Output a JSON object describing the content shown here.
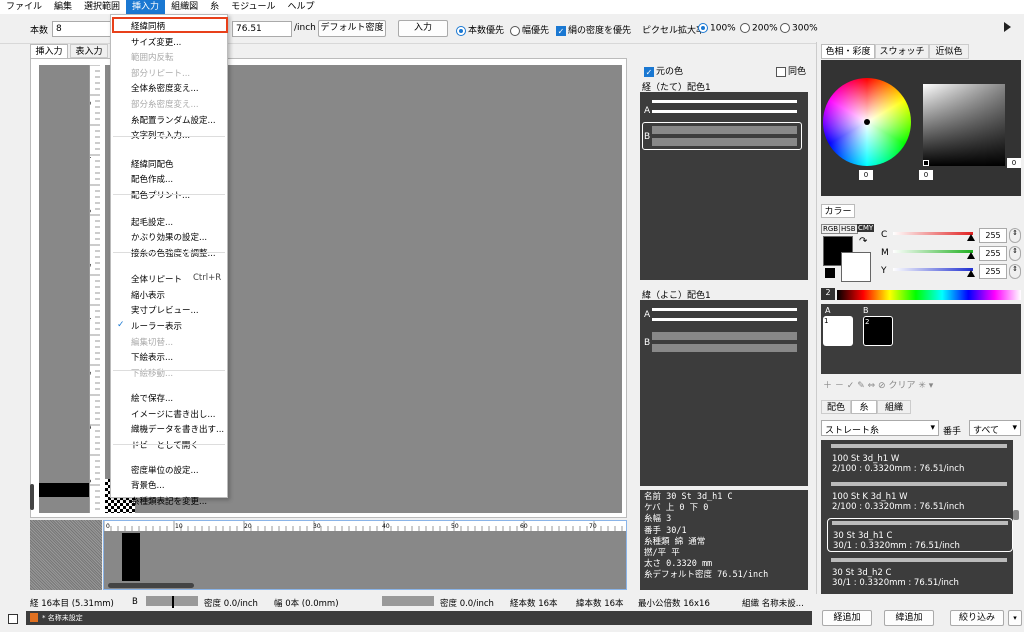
{
  "menubar": {
    "items": [
      "ファイル",
      "編集",
      "選択範囲",
      "挿入力",
      "組織図",
      "糸",
      "モジュール",
      "ヘルプ"
    ],
    "active_index": 3
  },
  "toolbar": {
    "count_label": "本数",
    "count_value": "8",
    "density_value": "76.51",
    "per_inch": "/inch",
    "default_density_btn": "デフォルト密度",
    "input_btn": "入力",
    "priority_count": "本数優先",
    "priority_width": "幅優先",
    "keep_density": "絹の密度を優先",
    "pixel_zoom_label": "ピクセル拡大率",
    "zoom_100": "100%",
    "zoom_200": "200%",
    "zoom_300": "300%",
    "play_icon": "play-icon"
  },
  "left_tabs": [
    "挿入力",
    "表入力"
  ],
  "dropdown": {
    "items": [
      {
        "label": "経緯同柄",
        "disabled": false,
        "highlighted": true
      },
      {
        "label": "サイズ変更...",
        "disabled": false
      },
      {
        "label": "範囲内反転",
        "disabled": true
      },
      {
        "label": "部分リピート...",
        "disabled": true
      },
      {
        "label": "全体糸密度変え...",
        "disabled": false
      },
      {
        "label": "部分糸密度変え...",
        "disabled": true
      },
      {
        "label": "糸配置ランダム設定...",
        "disabled": false
      },
      {
        "label": "文字列で入力...",
        "disabled": false
      },
      {
        "label": "経緯同配色",
        "disabled": false
      },
      {
        "label": "配色作成...",
        "disabled": false
      },
      {
        "label": "配色プリント...",
        "disabled": false
      },
      {
        "label": "起毛設定...",
        "disabled": false
      },
      {
        "label": "かぶり効果の設定...",
        "disabled": false
      },
      {
        "label": "接糸の色強度を調整...",
        "disabled": false
      },
      {
        "label": "全体リピート",
        "disabled": false,
        "shortcut": "Ctrl+R"
      },
      {
        "label": "縮小表示",
        "disabled": false
      },
      {
        "label": "実寸プレビュー...",
        "disabled": false
      },
      {
        "label": "ルーラー表示",
        "disabled": false,
        "checked": true
      },
      {
        "label": "編集切替...",
        "disabled": true
      },
      {
        "label": "下絵表示...",
        "disabled": false
      },
      {
        "label": "下絵移動...",
        "disabled": true
      },
      {
        "label": "絵で保存...",
        "disabled": false
      },
      {
        "label": "イメージに書き出し...",
        "disabled": false
      },
      {
        "label": "織機データを書き出す...",
        "disabled": false
      },
      {
        "label": "ドビーとして開く",
        "disabled": false
      },
      {
        "label": "密度単位の設定...",
        "disabled": false
      },
      {
        "label": "背景色...",
        "disabled": false
      },
      {
        "label": "糸種類表記を変更...",
        "disabled": false
      }
    ]
  },
  "ruler": {
    "vertical_ticks": [
      "8",
      "7",
      "6",
      "5",
      "4",
      "3",
      "2",
      "1"
    ],
    "horizontal_ticks": [
      "0",
      "10",
      "20",
      "30",
      "40",
      "50",
      "60",
      "70"
    ]
  },
  "warp_panel": {
    "original_color": "元の色",
    "same_color": "同色",
    "title": "経（たて）配色1",
    "rows": [
      "A",
      "B"
    ]
  },
  "weft_panel": {
    "title": "緯（よこ）配色1",
    "rows": [
      "A",
      "B"
    ]
  },
  "info_panel": {
    "lines": [
      "名前  30 St 3d_h1 C",
      "ケバ  上 0 下 0",
      "糸幅  3",
      "番手  30/1",
      "糸種類  綿  通常",
      "撚/平  平",
      "太さ  0.3320 mm",
      "糸デフォルト密度  76.51/inch"
    ]
  },
  "color_tabs": [
    "色相・彩度",
    "スウォッチ",
    "近似色"
  ],
  "color_values": {
    "hue": "0",
    "sat": "0",
    "val": "0"
  },
  "color_section": {
    "title": "カラー",
    "modes": [
      "RGB",
      "HSB",
      "CMY"
    ],
    "sliders": [
      {
        "label": "C",
        "value": "255",
        "color": "#e02020"
      },
      {
        "label": "M",
        "value": "255",
        "color": "#20b020"
      },
      {
        "label": "Y",
        "value": "255",
        "color": "#2030d0"
      }
    ]
  },
  "swatch_index": "2",
  "swatches": {
    "headers": [
      "A",
      "B"
    ],
    "items": [
      {
        "num": "1",
        "color": "#ffffff"
      },
      {
        "num": "2",
        "color": "#000000"
      }
    ],
    "clear_label": "クリア"
  },
  "yarn_tabs": [
    "配色",
    "糸",
    "組織"
  ],
  "yarn_filter": {
    "type": "ストレート糸",
    "count_label": "番手",
    "count_value": "すべて"
  },
  "yarn_list": [
    {
      "name": "100 St 3d_h1 W",
      "detail": "2/100 : 0.3320mm : 76.51/inch"
    },
    {
      "name": "100 St K 3d_h1 W",
      "detail": "2/100 : 0.3320mm : 76.51/inch"
    },
    {
      "name": "30 St 3d_h1 C",
      "detail": "30/1 : 0.3320mm : 76.51/inch",
      "selected": true
    },
    {
      "name": "30 St 3d_h2 C",
      "detail": "30/1 : 0.3320mm : 76.51/inch"
    }
  ],
  "bottom_buttons": [
    "経追加",
    "緯追加",
    "絞り込み"
  ],
  "statusbar": {
    "warp_pos": "経 16本目 (5.31mm)",
    "b_label": "B",
    "density1": "密度 0.0/inch",
    "width": "幅 0本 (0.0mm)",
    "density2": "密度 0.0/inch",
    "warp_count": "経本数 16本",
    "weft_count": "緯本数 16本",
    "lcm": "最小公倍数 16x16",
    "org_name": "組織 名称未設..."
  },
  "footer_tab": "* 名称未設定"
}
